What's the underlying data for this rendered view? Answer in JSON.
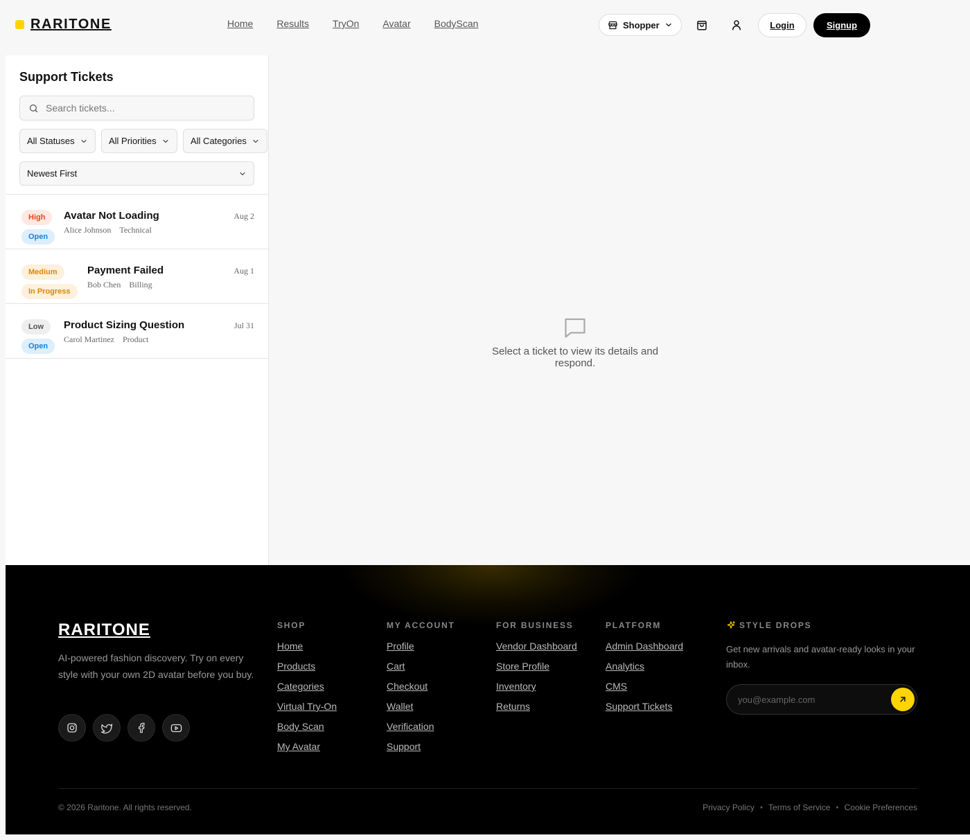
{
  "header": {
    "logo": "RARITONE",
    "nav": [
      "Home",
      "Results",
      "TryOn",
      "Avatar",
      "BodyScan"
    ],
    "role": "Shopper",
    "login_label": "Login",
    "signup_label": "Signup",
    "accent_color": "#FFD400"
  },
  "tickets_panel": {
    "title": "Support Tickets",
    "search_placeholder": "Search tickets...",
    "filters": [
      "All Statuses",
      "All Priorities",
      "All Categories"
    ],
    "sort": "Newest First",
    "tickets": [
      {
        "priority": "High",
        "status": "Open",
        "title": "Avatar Not Loading",
        "customer": "Alice Johnson",
        "category": "Technical",
        "date": "Aug 2"
      },
      {
        "priority": "Medium",
        "status": "In Progress",
        "title": "Payment Failed",
        "customer": "Bob Chen",
        "category": "Billing",
        "date": "Aug 1"
      },
      {
        "priority": "Low",
        "status": "Open",
        "title": "Product Sizing Question",
        "customer": "Carol Martinez",
        "category": "Product",
        "date": "Jul 31"
      }
    ]
  },
  "detail": {
    "empty_text": "Select a ticket to view its details and respond."
  },
  "footer": {
    "logo": "RARITONE",
    "description": "AI-powered fashion discovery. Try on every style with your own 2D avatar before you buy.",
    "socials": [
      "instagram-icon",
      "twitter-icon",
      "facebook-icon",
      "youtube-icon"
    ],
    "columns": [
      {
        "title": "SHOP",
        "links": [
          "Home",
          "Products",
          "Categories",
          "Virtual Try-On",
          "Body Scan",
          "My Avatar"
        ]
      },
      {
        "title": "MY ACCOUNT",
        "links": [
          "Profile",
          "Cart",
          "Checkout",
          "Wallet",
          "Verification",
          "Support"
        ]
      },
      {
        "title": "FOR BUSINESS",
        "links": [
          "Vendor Dashboard",
          "Store Profile",
          "Inventory",
          "Returns"
        ]
      },
      {
        "title": "PLATFORM",
        "links": [
          "Admin Dashboard",
          "Analytics",
          "CMS",
          "Support Tickets"
        ]
      }
    ],
    "newsletter": {
      "title": "STYLE DROPS",
      "description": "Get new arrivals and avatar-ready looks in your inbox.",
      "placeholder": "you@example.com"
    },
    "copyright": "© 2026 Raritone. All rights reserved.",
    "legal": [
      "Privacy Policy",
      "Terms of Service",
      "Cookie Preferences"
    ]
  }
}
